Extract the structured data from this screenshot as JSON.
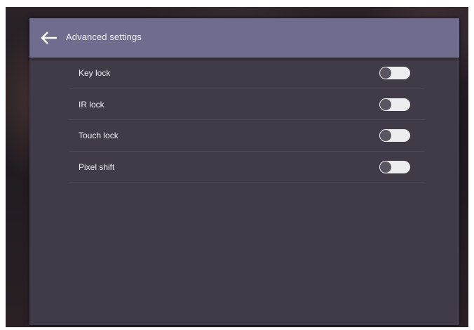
{
  "header": {
    "title": "Advanced settings",
    "back_icon": "arrow-left-icon"
  },
  "settings": [
    {
      "label": "Key lock",
      "enabled": false
    },
    {
      "label": "IR lock",
      "enabled": false
    },
    {
      "label": "Touch lock",
      "enabled": false
    },
    {
      "label": "Pixel shift",
      "enabled": false
    }
  ],
  "colors": {
    "header_bg": "#6f6c8d",
    "panel_bg": "#413b48",
    "toggle_track_off": "#ededf0",
    "toggle_knob_off": "#5a5660"
  }
}
